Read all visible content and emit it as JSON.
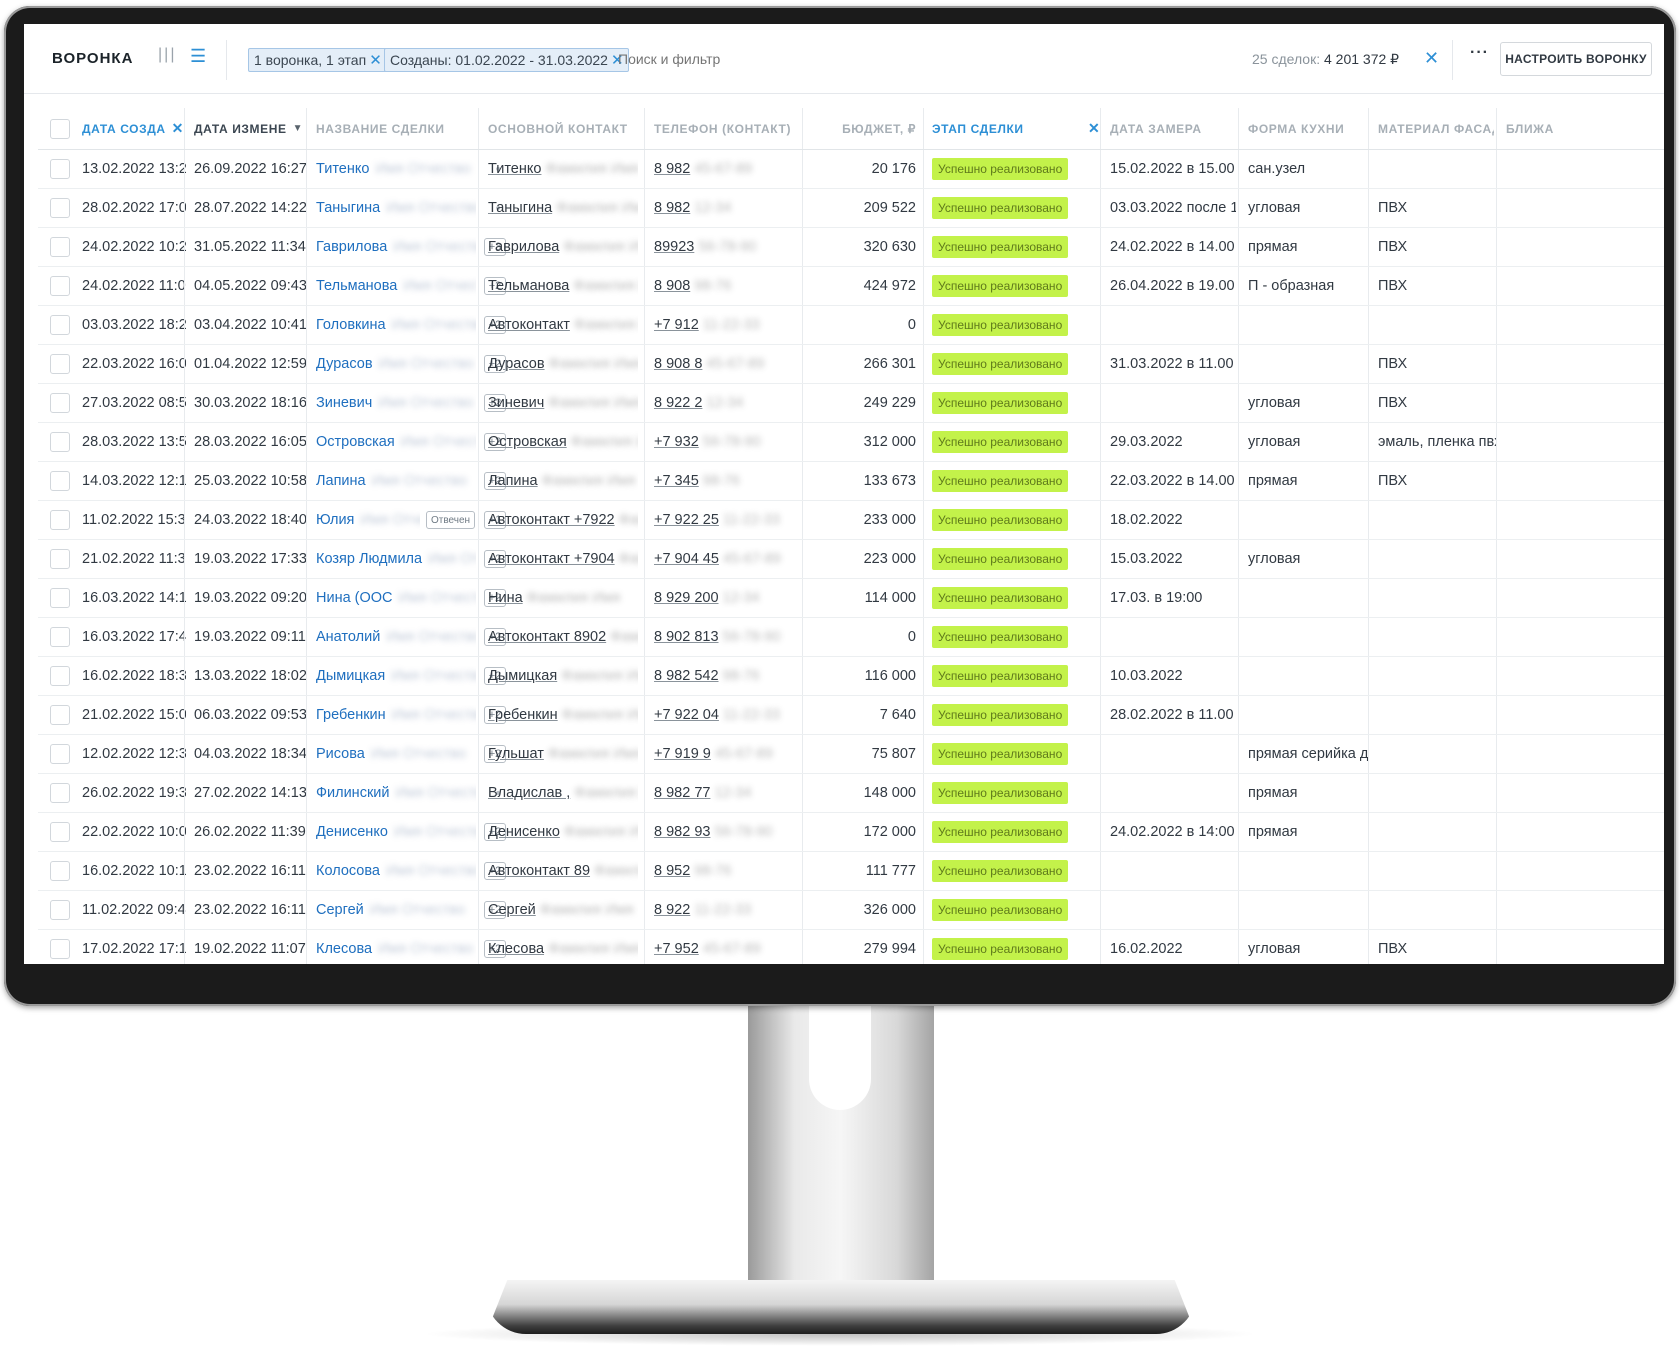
{
  "header": {
    "title": "ВОРОНКА",
    "filters": [
      {
        "label": "1 воронка, 1 этап"
      },
      {
        "label": "Созданы: 01.02.2022 - 31.03.2022"
      }
    ],
    "search_placeholder": "Поиск и фильтр",
    "summary_count": "25 сделок:",
    "summary_total": "4 201 372 ₽",
    "more_label": "···",
    "configure_button": "НАСТРОИТЬ ВОРОНКУ"
  },
  "columns": {
    "created": "ДАТА СОЗДА",
    "modified": "ДАТА ИЗМЕНЕ",
    "name": "НАЗВАНИЕ СДЕЛКИ",
    "contact": "ОСНОВНОЙ КОНТАКТ",
    "phone": "ТЕЛЕФОН (КОНТАКТ)",
    "budget": "БЮДЖЕТ, ₽",
    "stage": "ЭТАП СДЕЛКИ",
    "measure": "ДАТА ЗАМЕРА",
    "kitchen": "ФОРМА КУХНИ",
    "material": "МАТЕРИАЛ ФАСАД",
    "near": "БЛИЖА"
  },
  "stage_label": "Успешно реализовано",
  "rows": [
    {
      "created": "13.02.2022 13:2",
      "modified": "26.09.2022 16:27",
      "name": "Титенко",
      "badge": "•",
      "contact": "Титенко",
      "phone": "8 982",
      "budget": "20 176",
      "measure": "15.02.2022 в 15.00",
      "kitchen": "сан.узел",
      "material": ""
    },
    {
      "created": "28.02.2022 17:0",
      "modified": "28.07.2022 14:22",
      "name": "Таныгина",
      "badge": "•",
      "contact": "Таныгина",
      "phone": "8 982",
      "budget": "209 522",
      "measure": "03.03.2022 после 1",
      "kitchen": "угловая",
      "material": "ПВХ"
    },
    {
      "created": "24.02.2022 10:2",
      "modified": "31.05.2022 11:34",
      "name": "Гаврилова",
      "badge": "+3",
      "contact": "Гаврилова",
      "phone": "89923",
      "budget": "320 630",
      "measure": "24.02.2022 в 14.00",
      "kitchen": "прямая",
      "material": "ПВХ"
    },
    {
      "created": "24.02.2022 11:0",
      "modified": "04.05.2022 09:43",
      "name": "Тельманова",
      "badge": "+2",
      "contact": "Тельманова",
      "phone": "8 908",
      "budget": "424 972",
      "measure": "26.04.2022 в 19.00",
      "kitchen": "П - образная",
      "material": "ПВХ"
    },
    {
      "created": "03.03.2022 18:2",
      "modified": "03.04.2022 10:41",
      "name": "Головкина",
      "badge": "+2",
      "contact": "Автоконтакт",
      "phone": "+7 912",
      "budget": "0",
      "measure": "",
      "kitchen": "",
      "material": ""
    },
    {
      "created": "22.03.2022 16:0",
      "modified": "01.04.2022 12:59",
      "name": "Дурасов",
      "badge": "+2",
      "contact": "Дурасов",
      "phone": "8 908 8",
      "budget": "266 301",
      "measure": "31.03.2022 в 11.00",
      "kitchen": "",
      "material": "ПВХ"
    },
    {
      "created": "27.03.2022 08:5",
      "modified": "30.03.2022 18:16",
      "name": "Зиневич",
      "badge": "+2",
      "contact": "Зиневич",
      "phone": "8 922 2",
      "budget": "249 229",
      "measure": "",
      "kitchen": "угловая",
      "material": "ПВХ"
    },
    {
      "created": "28.03.2022 13:5",
      "modified": "28.03.2022 16:05",
      "name": "Островская",
      "badge": "+2",
      "contact": "Островская",
      "phone": "+7 932",
      "budget": "312 000",
      "measure": "29.03.2022",
      "kitchen": "угловая",
      "material": "эмаль, пленка пвх"
    },
    {
      "created": "14.03.2022 12:1",
      "modified": "25.03.2022 10:58",
      "name": "Лапина",
      "badge": "+2",
      "contact": "Лапина",
      "phone": "+7 345",
      "budget": "133 673",
      "measure": "22.03.2022 в 14.00",
      "kitchen": "прямая",
      "material": "ПВХ"
    },
    {
      "created": "11.02.2022 15:3",
      "modified": "24.03.2022 18:40",
      "name": "Юлия",
      "badge": "+1",
      "missed": "Отвечен",
      "contact": "Автоконтакт +7922",
      "phone": "+7 922 25",
      "budget": "233 000",
      "measure": "18.02.2022",
      "kitchen": "",
      "material": ""
    },
    {
      "created": "21.02.2022 11:3",
      "modified": "19.03.2022 17:33",
      "name": "Козяр Людмила",
      "badge": "+2",
      "contact": "Автоконтакт +7904",
      "phone": "+7 904 45",
      "budget": "223 000",
      "measure": "15.03.2022",
      "kitchen": "угловая",
      "material": ""
    },
    {
      "created": "16.03.2022 14:1",
      "modified": "19.03.2022 09:20",
      "name": "Нина (ООС",
      "badge": "+2",
      "contact": "Нина",
      "phone": "8 929 200",
      "budget": "114 000",
      "measure": "17.03. в 19:00",
      "kitchen": "",
      "material": ""
    },
    {
      "created": "16.03.2022 17:4",
      "modified": "19.03.2022 09:11",
      "name": "Анатолий",
      "badge": "+2",
      "contact": "Автоконтакт 8902",
      "phone": "8 902 813",
      "budget": "0",
      "measure": "",
      "kitchen": "",
      "material": ""
    },
    {
      "created": "16.02.2022 18:3",
      "modified": "13.03.2022 18:02",
      "name": "Дымицкая",
      "badge": "+2",
      "contact": "Дымицкая",
      "phone": "8 982 542",
      "budget": "116 000",
      "measure": "10.03.2022",
      "kitchen": "",
      "material": ""
    },
    {
      "created": "21.02.2022 15:0",
      "modified": "06.03.2022 09:53",
      "name": "Гребенкин",
      "badge": "+2",
      "contact": "Гребенкин",
      "phone": "+7 922 04",
      "budget": "7 640",
      "measure": "28.02.2022 в 11.00",
      "kitchen": "",
      "material": ""
    },
    {
      "created": "12.02.2022 12:3",
      "modified": "04.03.2022 18:34",
      "name": "Рисова",
      "badge": "+2",
      "contact": "Гульшат",
      "phone": "+7 919 9",
      "budget": "75 807",
      "measure": "",
      "kitchen": "прямая серийка де",
      "material": ""
    },
    {
      "created": "26.02.2022 19:3",
      "modified": "27.02.2022 14:13",
      "name": "Филинский",
      "badge": "•",
      "contact": "Владислав ,",
      "phone": "8 982 77",
      "budget": "148 000",
      "measure": "",
      "kitchen": "прямая",
      "material": ""
    },
    {
      "created": "22.02.2022 10:0",
      "modified": "26.02.2022 11:39",
      "name": "Денисенко",
      "badge": "+2",
      "contact": "Денисенко",
      "phone": "8 982 93",
      "budget": "172 000",
      "measure": "24.02.2022 в 14:00",
      "kitchen": "прямая",
      "material": ""
    },
    {
      "created": "16.02.2022 10:1",
      "modified": "23.02.2022 16:11",
      "name": "Колосова",
      "badge": "+2",
      "contact": "Автоконтакт 89",
      "phone": "8 952",
      "budget": "111 777",
      "measure": "",
      "kitchen": "",
      "material": ""
    },
    {
      "created": "11.02.2022 09:4",
      "modified": "23.02.2022 16:11",
      "name": "Сергей",
      "badge": "+2",
      "contact": "Сергей",
      "phone": "8 922",
      "budget": "326 000",
      "measure": "",
      "kitchen": "",
      "material": ""
    },
    {
      "created": "17.02.2022 17:1",
      "modified": "19.02.2022 11:07",
      "name": "Клесова",
      "badge": "+2",
      "contact": "Клесова",
      "phone": "+7 952",
      "budget": "279 994",
      "measure": "16.02.2022",
      "kitchen": "угловая",
      "material": "ПВХ"
    }
  ]
}
